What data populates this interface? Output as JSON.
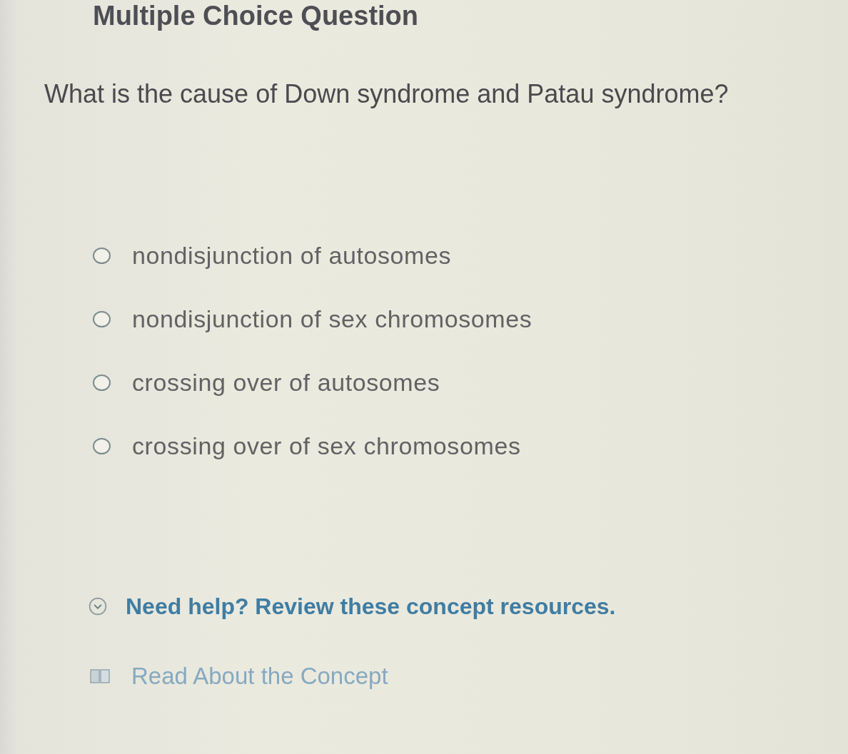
{
  "header": {
    "title": "Multiple Choice Question"
  },
  "question": {
    "text": "What is the cause of Down syndrome and Patau syndrome?"
  },
  "options": [
    {
      "label": "nondisjunction of autosomes",
      "selected": false
    },
    {
      "label": "nondisjunction of sex chromosomes",
      "selected": false
    },
    {
      "label": "crossing over of autosomes",
      "selected": false
    },
    {
      "label": "crossing over of sex chromosomes",
      "selected": false
    }
  ],
  "help": {
    "text": "Need help? Review these concept resources.",
    "expanded": true
  },
  "resources": [
    {
      "label": "Read About the Concept"
    }
  ]
}
